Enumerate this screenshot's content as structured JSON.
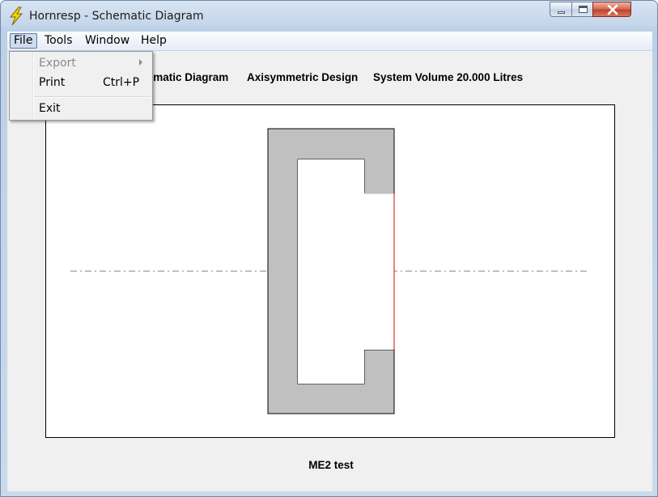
{
  "window": {
    "title": "Hornresp - Schematic Diagram",
    "app_icon": "lightning-bolt-icon",
    "controls": [
      "minimize-icon",
      "maximize-icon",
      "close-icon"
    ]
  },
  "menubar": {
    "file": "File",
    "tools": "Tools",
    "window": "Window",
    "help": "Help"
  },
  "file_menu": {
    "export": "Export",
    "print": "Print",
    "print_shortcut": "Ctrl+P",
    "exit": "Exit"
  },
  "header": {
    "diagram": "Schematic Diagram",
    "design": "Axisymmetric Design",
    "volume": "System Volume 20.000 Litres"
  },
  "footer": {
    "label": "ME2 test"
  },
  "colors": {
    "enclosure": "#c0c0c0",
    "diaphragm": "#e00000",
    "axis_line": "#808080"
  }
}
